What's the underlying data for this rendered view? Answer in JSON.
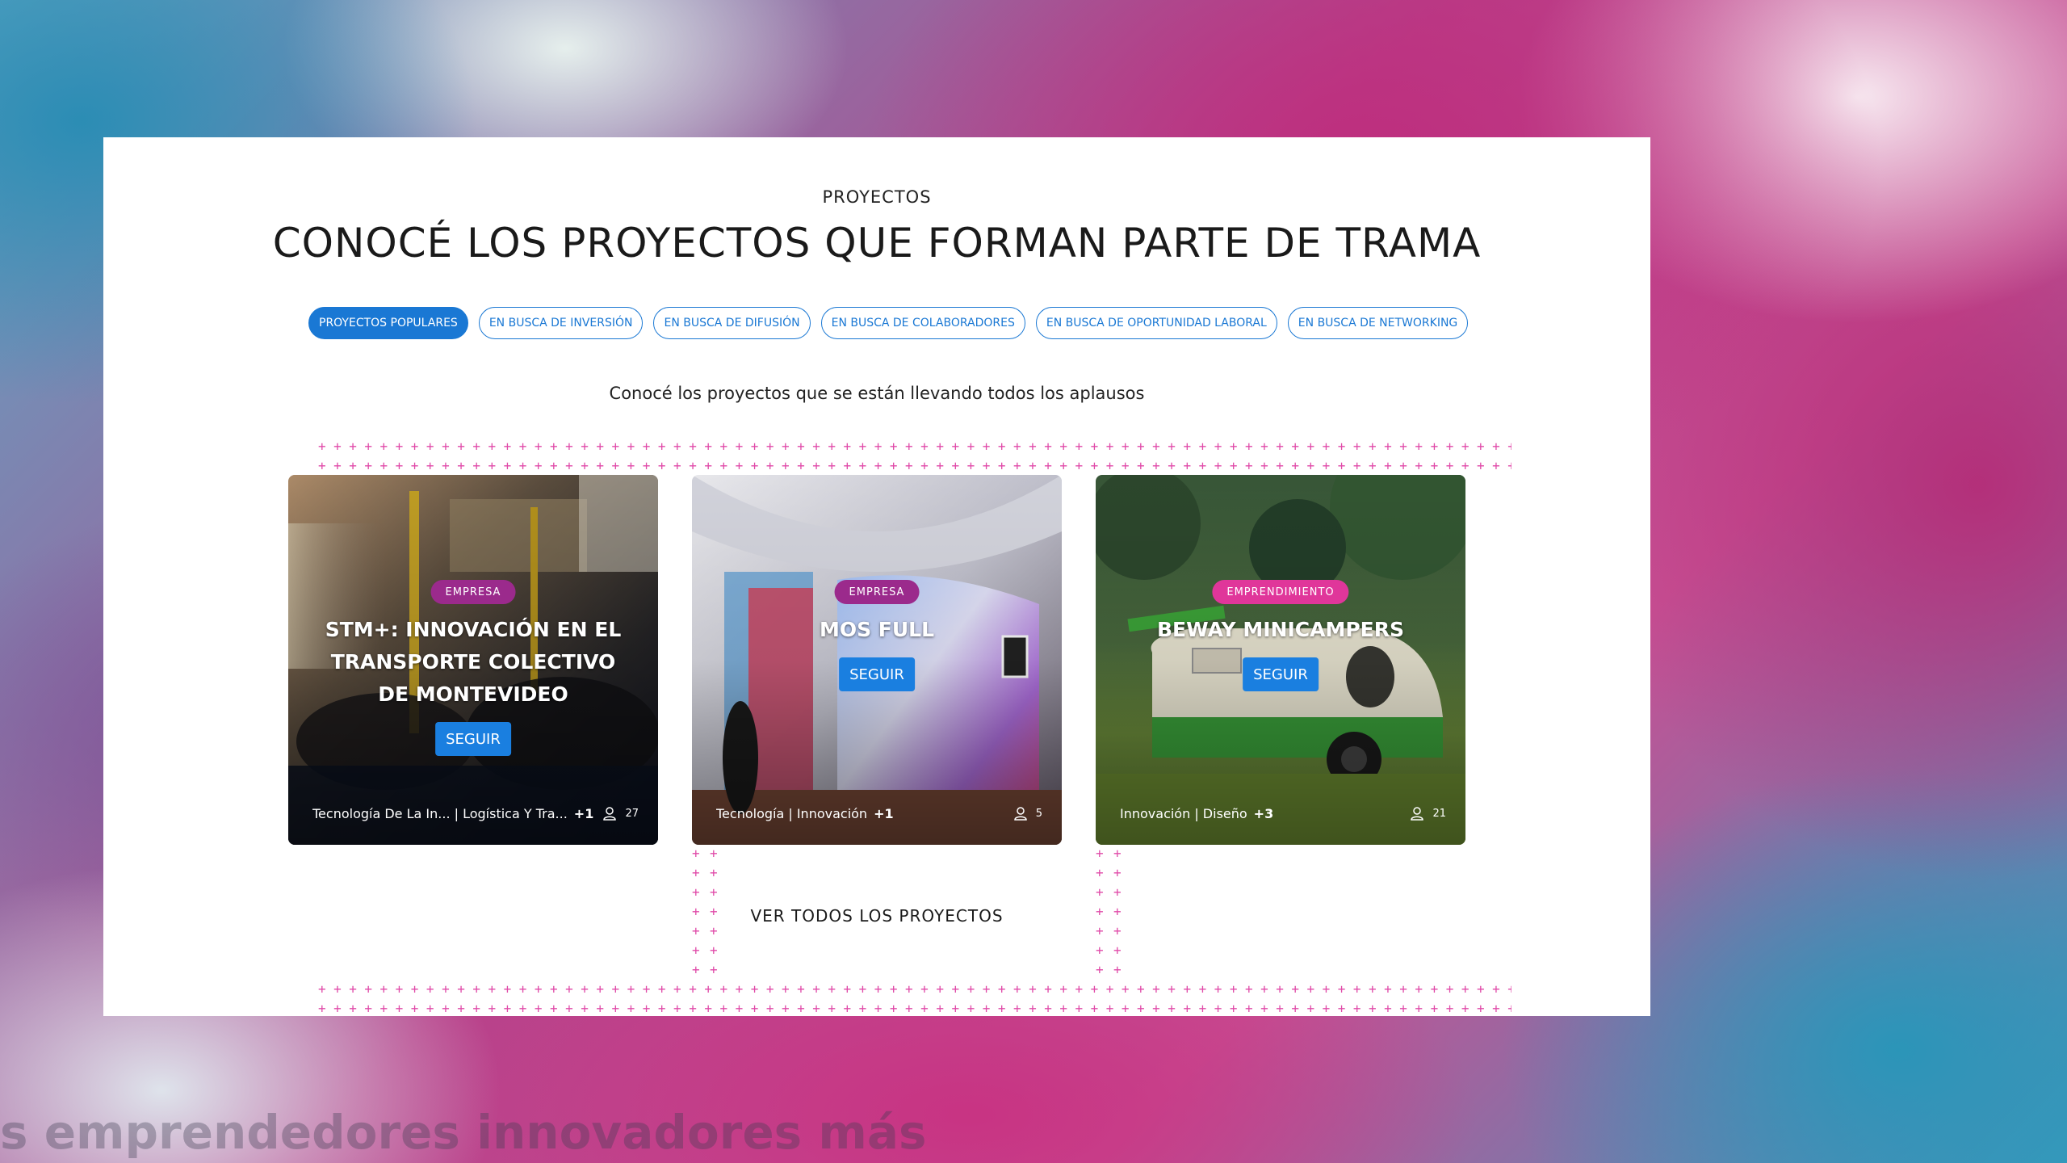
{
  "background_text": "s emprendedores innovadores más",
  "section": {
    "eyebrow": "PROYECTOS",
    "title": "CONOCÉ LOS PROYECTOS QUE FORMAN PARTE DE TRAMA",
    "subtitle": "Conocé los proyectos que se están llevando todos los aplausos",
    "see_all_label": "VER TODOS LOS PROYECTOS"
  },
  "tabs": [
    {
      "label": "PROYECTOS POPULARES",
      "active": true
    },
    {
      "label": "EN BUSCA DE INVERSIÓN",
      "active": false
    },
    {
      "label": "EN BUSCA DE DIFUSIÓN",
      "active": false
    },
    {
      "label": "EN BUSCA DE COLABORADORES",
      "active": false
    },
    {
      "label": "EN BUSCA DE OPORTUNIDAD LABORAL",
      "active": false
    },
    {
      "label": "EN BUSCA DE NETWORKING",
      "active": false
    }
  ],
  "cards": [
    {
      "badge": "EMPRESA",
      "title": "STM+: INNOVACIÓN EN EL TRANSPORTE COLECTIVO DE MONTEVIDEO",
      "follow_label": "SEGUIR",
      "tags": "Tecnología De La In... | Logística Y Tra...",
      "more": "+1",
      "followers": "27"
    },
    {
      "badge": "EMPRESA",
      "title": "MOS FULL",
      "follow_label": "SEGUIR",
      "tags": "Tecnología | Innovación",
      "more": "+1",
      "followers": "5"
    },
    {
      "badge": "EMPRENDIMIENTO",
      "title": "BEWAY MINICAMPERS",
      "follow_label": "SEGUIR",
      "tags": "Innovación | Diseño",
      "more": "+3",
      "followers": "21"
    }
  ],
  "colors": {
    "accent_blue": "#1a78d4",
    "badge_empresa": "#9b2a8c",
    "badge_emprendimiento": "#e0369a",
    "pattern_pink": "#e04aa8"
  }
}
